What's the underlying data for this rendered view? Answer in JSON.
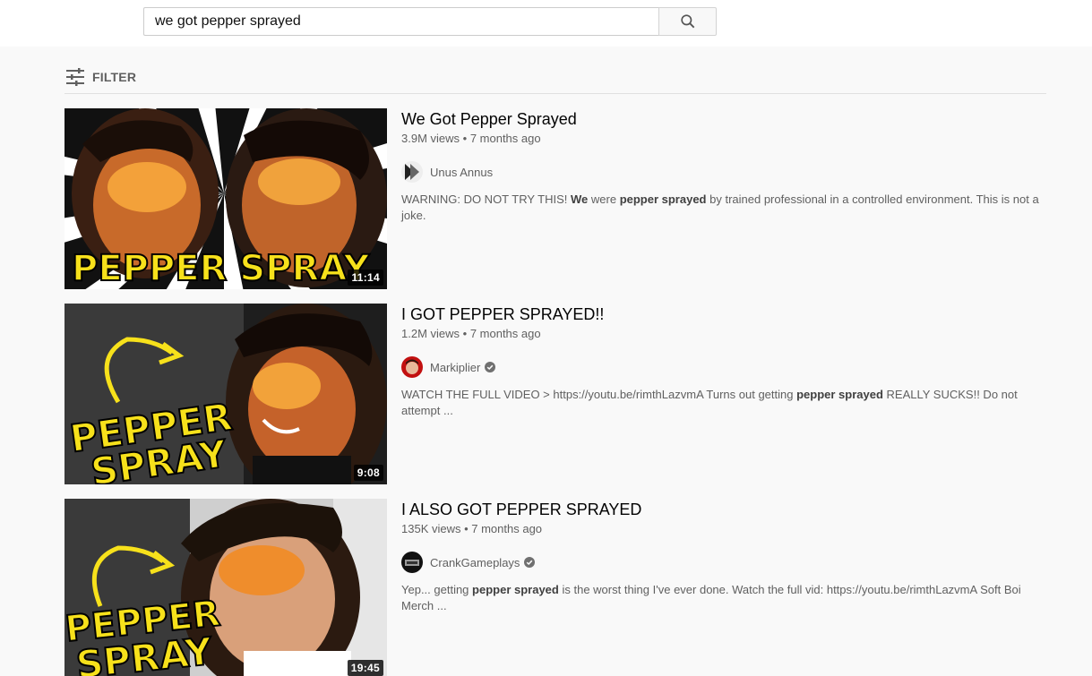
{
  "search": {
    "query": "we got pepper sprayed"
  },
  "filter": {
    "label": "FILTER"
  },
  "results": [
    {
      "title": "We Got Pepper Sprayed",
      "views": "3.9M views",
      "sep": " • ",
      "age": "7 months ago",
      "channel": "Unus Annus",
      "verified": false,
      "duration": "11:14",
      "thumb_text": "PEPPER SPRAY",
      "description": [
        {
          "t": "WARNING: DO NOT TRY THIS! ",
          "b": false
        },
        {
          "t": "We",
          "b": true
        },
        {
          "t": " were ",
          "b": false
        },
        {
          "t": "pepper sprayed",
          "b": true
        },
        {
          "t": " by trained professional in a controlled environment. This is not a joke.",
          "b": false
        }
      ]
    },
    {
      "title": "I GOT PEPPER SPRAYED!!",
      "views": "1.2M views",
      "sep": " • ",
      "age": "7 months ago",
      "channel": "Markiplier",
      "verified": true,
      "duration": "9:08",
      "thumb_text_1": "PEPPER",
      "thumb_text_2": "SPRAY",
      "description": [
        {
          "t": "WATCH THE FULL VIDEO > https://youtu.be/rimthLazvmA Turns out getting ",
          "b": false
        },
        {
          "t": "pepper sprayed",
          "b": true
        },
        {
          "t": " REALLY SUCKS!! Do not attempt ...",
          "b": false
        }
      ]
    },
    {
      "title": "I ALSO GOT PEPPER SPRAYED",
      "views": "135K views",
      "sep": " • ",
      "age": "7 months ago",
      "channel": "CrankGameplays",
      "verified": true,
      "duration": "19:45",
      "thumb_text_1": "PEPPER",
      "thumb_text_2": "SPRAY",
      "description": [
        {
          "t": "Yep... getting ",
          "b": false
        },
        {
          "t": "pepper sprayed",
          "b": true
        },
        {
          "t": " is the worst thing I've ever done. Watch the full vid: https://youtu.be/rimthLazvmA Soft Boi Merch ...",
          "b": false
        }
      ]
    }
  ],
  "colors": {
    "thumb_yellow": "#f7e11b",
    "face_orange": "#e8802a",
    "text_secondary": "#606060"
  }
}
